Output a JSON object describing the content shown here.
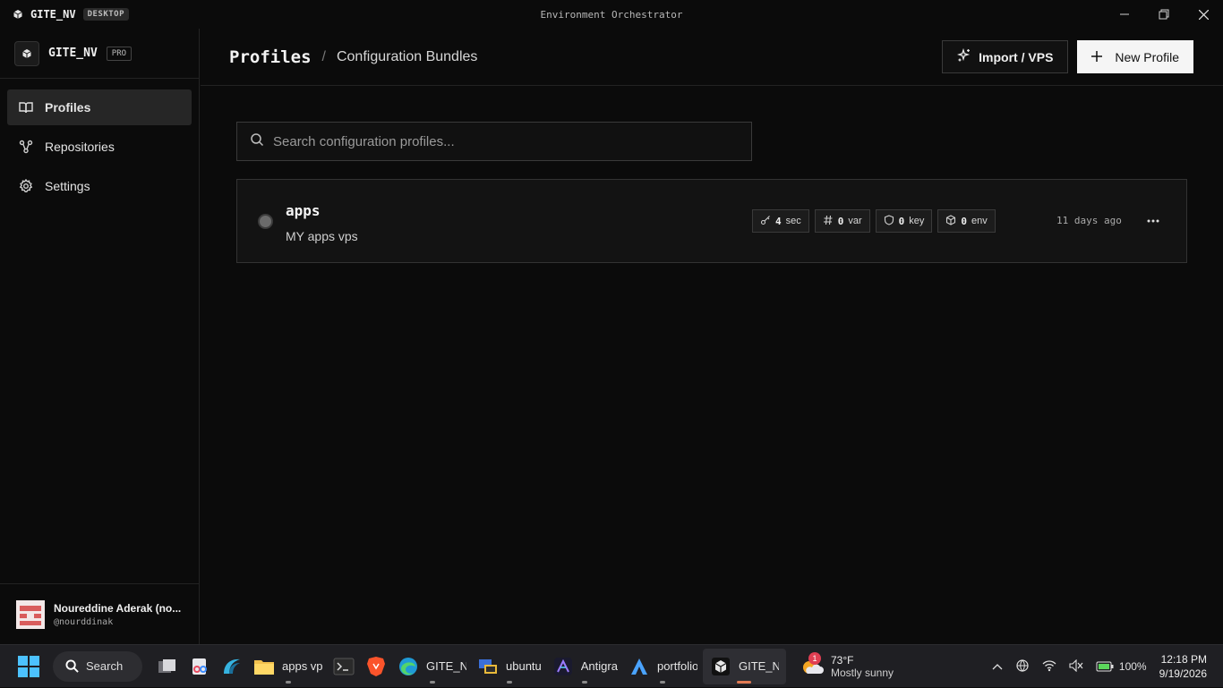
{
  "titlebar": {
    "app_name": "GITE_NV",
    "badge": "DESKTOP",
    "window_title": "Environment Orchestrator",
    "controls": [
      "minimize",
      "restore",
      "close"
    ]
  },
  "sidebar": {
    "brand": "GITE_NV",
    "plan_badge": "PRO",
    "items": [
      {
        "label": "Profiles",
        "icon": "book-icon",
        "active": true
      },
      {
        "label": "Repositories",
        "icon": "git-branch-icon",
        "active": false
      },
      {
        "label": "Settings",
        "icon": "gear-icon",
        "active": false
      }
    ],
    "user": {
      "name": "Noureddine Aderak (no...",
      "handle": "@nourddinak"
    }
  },
  "header": {
    "title": "Profiles",
    "separator": "/",
    "subtitle": "Configuration Bundles",
    "import_label": "Import / VPS",
    "new_label": "New Profile"
  },
  "search": {
    "placeholder": "Search configuration profiles..."
  },
  "profiles": [
    {
      "name": "apps",
      "description": "MY apps vps",
      "status_color": "#6b6b6b",
      "tags": [
        {
          "icon": "key-icon",
          "count": "4",
          "unit": "sec"
        },
        {
          "icon": "hash-icon",
          "count": "0",
          "unit": "var"
        },
        {
          "icon": "shield-icon",
          "count": "0",
          "unit": "key"
        },
        {
          "icon": "box-icon",
          "count": "0",
          "unit": "env"
        }
      ],
      "updated": "11 days ago"
    }
  ],
  "taskbar": {
    "search_label": "Search",
    "apps": [
      {
        "label": "",
        "icon": "task-view-icon"
      },
      {
        "label": "",
        "icon": "snipping-tool-icon"
      },
      {
        "label": "",
        "icon": "wave-app-icon"
      },
      {
        "label": "apps vp",
        "icon": "folder-icon"
      },
      {
        "label": "",
        "icon": "terminal-icon"
      },
      {
        "label": "",
        "icon": "brave-icon"
      },
      {
        "label": "GITE_NV",
        "icon": "edge-icon"
      },
      {
        "label": "ubuntu",
        "icon": "remote-icon"
      },
      {
        "label": "Antigra",
        "icon": "antigravity-icon"
      },
      {
        "label": "portfolio",
        "icon": "a-app-icon"
      },
      {
        "label": "GITE_NV",
        "icon": "gite-icon",
        "active": true
      }
    ],
    "weather": {
      "badge": "1",
      "temp": "73°F",
      "desc": "Mostly sunny"
    },
    "battery": "100%",
    "time": "12:18 PM",
    "date": "9/19/2026"
  },
  "colors": {
    "background": "#0b0b0b",
    "accent_active": "#e27b54",
    "weather_badge": "#e03e52"
  }
}
